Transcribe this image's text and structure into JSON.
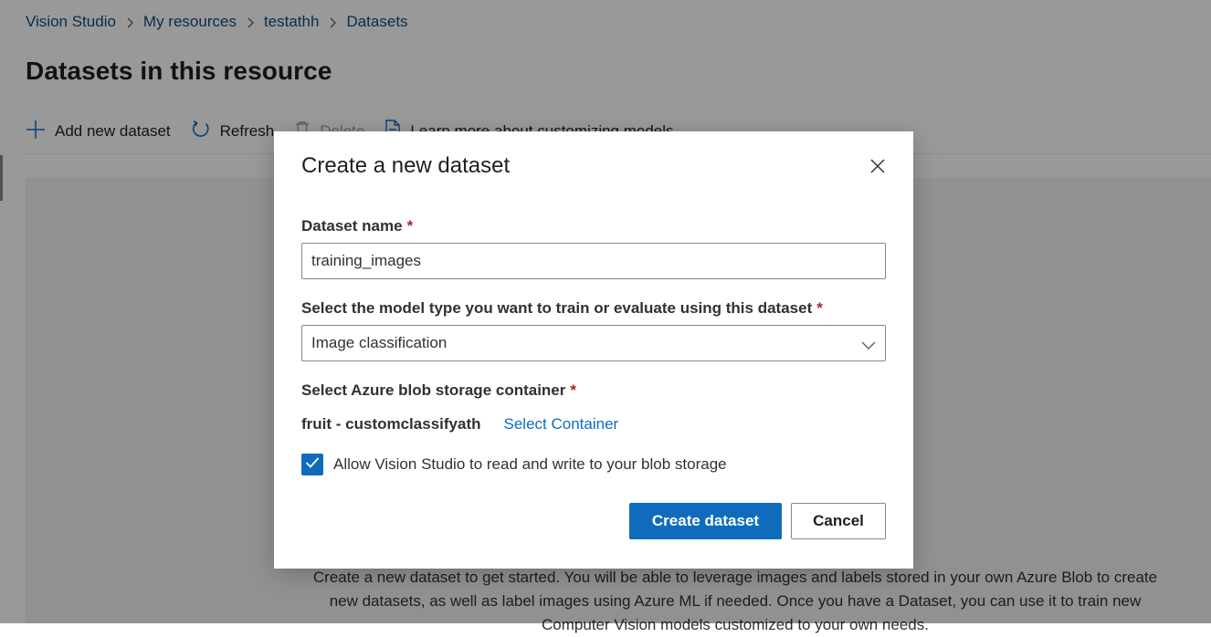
{
  "breadcrumb": {
    "items": [
      "Vision Studio",
      "My resources",
      "testathh",
      "Datasets"
    ]
  },
  "page": {
    "title": "Datasets in this resource"
  },
  "toolbar": {
    "add_label": "Add new dataset",
    "refresh_label": "Refresh",
    "delete_label": "Delete",
    "learn_label": "Learn more about customizing models"
  },
  "empty_state": {
    "text": "Create a new dataset to get started. You will be able to leverage images and labels stored in your own Azure Blob to create new datasets, as well as label images using Azure ML if needed. Once you have a Dataset, you can use it to train new Computer Vision models customized to your own needs."
  },
  "dialog": {
    "title": "Create a new dataset",
    "name_label": "Dataset name",
    "name_value": "training_images",
    "required_mark": "*",
    "model_type_label": "Select the model type you want to train or evaluate using this dataset",
    "model_type_value": "Image classification",
    "container_label": "Select Azure blob storage container",
    "container_value": "fruit - customclassifyath",
    "select_container_link": "Select Container",
    "checkbox_label": "Allow Vision Studio to read and write to your blob storage",
    "checkbox_checked": true,
    "create_button": "Create dataset",
    "cancel_button": "Cancel"
  },
  "colors": {
    "primary": "#0f6cbd",
    "required": "#a4262c",
    "breadcrumb_link": "#0f4c81",
    "overlay": "rgba(0,0,0,0.40)"
  }
}
